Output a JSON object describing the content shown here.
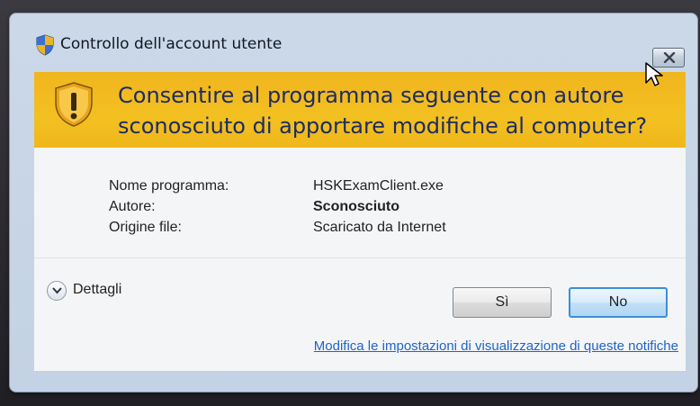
{
  "window": {
    "title": "Controllo dell'account utente",
    "close_icon": "close-icon"
  },
  "banner": {
    "question": "Consentire al programma seguente con autore sconosciuto di apportare modifiche al computer?",
    "icon": "warning-shield-icon",
    "color": "#f3c021"
  },
  "details": {
    "program_label": "Nome programma:",
    "program_value": "HSKExamClient.exe",
    "author_label": "Autore:",
    "author_value": "Sconosciuto",
    "origin_label": "Origine file:",
    "origin_value": "Scaricato da Internet"
  },
  "footer": {
    "details_toggle_label": "Dettagli",
    "yes_label": "Sì",
    "no_label": "No",
    "settings_link": "Modifica le impostazioni di visualizzazione di queste notifiche"
  }
}
